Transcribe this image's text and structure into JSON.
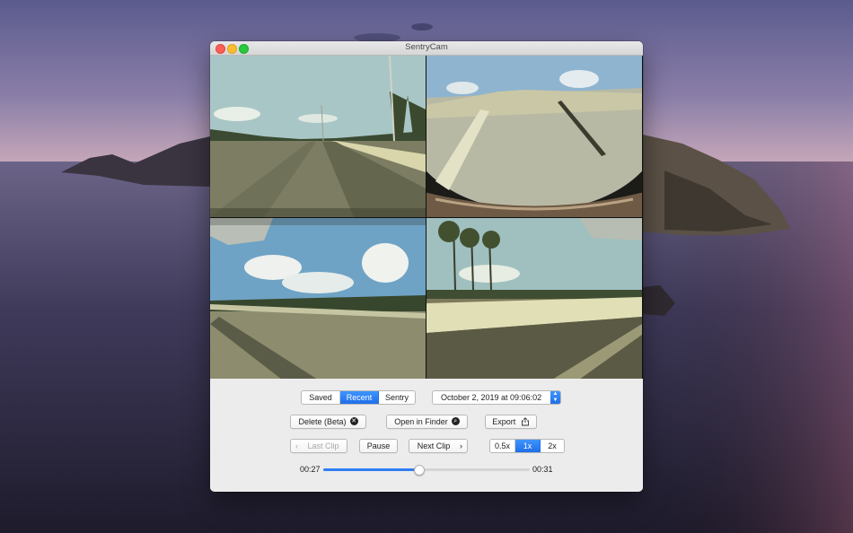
{
  "window": {
    "title": "SentryCam"
  },
  "source_tabs": {
    "items": [
      "Saved",
      "Recent",
      "Sentry"
    ],
    "selected": "Recent"
  },
  "date_picker": {
    "value": "October 2, 2019 at 09:06:02"
  },
  "actions": {
    "delete_label": "Delete (Beta)",
    "open_finder_label": "Open in Finder",
    "export_label": "Export"
  },
  "playback": {
    "last_clip_label": "Last Clip",
    "pause_label": "Pause",
    "next_clip_label": "Next Clip"
  },
  "speed": {
    "items": [
      "0.5x",
      "1x",
      "2x"
    ],
    "selected": "1x"
  },
  "timeline": {
    "current": "00:27",
    "end": "00:31",
    "progress": 0.46
  },
  "colors": {
    "accent": "#2f7ef2",
    "close": "#fe5f57",
    "minimize": "#febc2e",
    "maximize": "#28c840"
  },
  "icons": {
    "delete": "x-circle-icon",
    "finder": "magnifier-circle-icon",
    "export": "share-icon",
    "last_clip": "chevron-left-icon",
    "next_clip": "chevron-right-icon",
    "date_stepper": "up-down-stepper-icon"
  }
}
